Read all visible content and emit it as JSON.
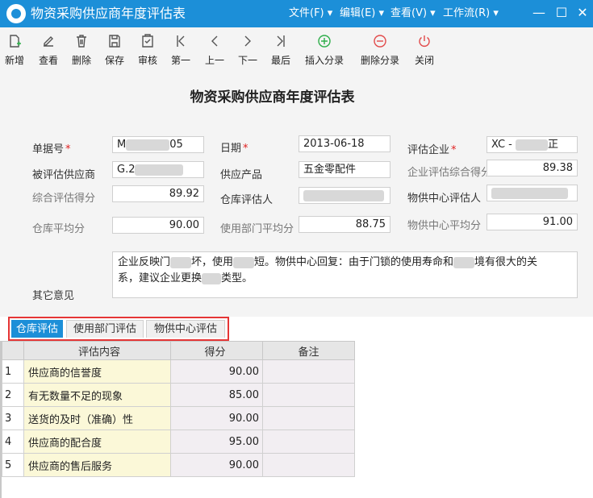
{
  "window": {
    "title": "物资采购供应商年度评估表"
  },
  "menu": [
    {
      "label": "文件(F)"
    },
    {
      "label": "编辑(E)"
    },
    {
      "label": "查看(V)"
    },
    {
      "label": "工作流(R)"
    }
  ],
  "toolbar": [
    {
      "label": "新增",
      "icon": "new-doc-icon"
    },
    {
      "label": "查看",
      "icon": "edit-icon"
    },
    {
      "label": "删除",
      "icon": "trash-icon"
    },
    {
      "label": "保存",
      "icon": "save-icon"
    },
    {
      "label": "审核",
      "icon": "audit-icon"
    },
    {
      "label": "第一",
      "icon": "first-icon"
    },
    {
      "label": "上一",
      "icon": "prev-icon"
    },
    {
      "label": "下一",
      "icon": "next-icon"
    },
    {
      "label": "最后",
      "icon": "last-icon"
    },
    {
      "label": "插入分录",
      "icon": "plus-circle-icon",
      "color": "#2eae4a"
    },
    {
      "label": "删除分录",
      "icon": "minus-circle-icon",
      "color": "#e24a4a"
    },
    {
      "label": "关闭",
      "icon": "power-icon",
      "color": "#e24a4a"
    }
  ],
  "form": {
    "title": "物资采购供应商年度评估表",
    "doc_no_label": "单据号",
    "doc_no_prefix": "M",
    "doc_no_suffix": "05",
    "date_label": "日期",
    "date_value": "2013-06-18",
    "eval_company_label": "评估企业",
    "eval_company_prefix": "XC -",
    "eval_company_suffix": "正",
    "supplier_label": "被评估供应商",
    "supplier_prefix": "G.2",
    "product_label": "供应产品",
    "product_value": "五金零配件",
    "company_score_label": "企业评估综合得分",
    "company_score_value": "89.38",
    "overall_score_label": "综合评估得分",
    "overall_score_value": "89.92",
    "warehouse_evaluator_label": "仓库评估人",
    "supply_center_evaluator_label": "物供中心评估人",
    "warehouse_avg_label": "仓库平均分",
    "warehouse_avg_value": "90.00",
    "dept_avg_label": "使用部门平均分",
    "dept_avg_value": "88.75",
    "supply_center_avg_label": "物供中心平均分",
    "supply_center_avg_value": "91.00",
    "remark_label": "其它意见",
    "remark_line1_a": "企业反映门",
    "remark_line1_b": "坏，使用",
    "remark_line1_c": "短。物供中心回复：由于门锁的使用寿命和",
    "remark_line1_d": "境有很大的关",
    "remark_line2_a": "系，建议企业更换",
    "remark_line2_b": "类型。"
  },
  "tabs": [
    {
      "label": "仓库评估",
      "active": true
    },
    {
      "label": "使用部门评估",
      "active": false
    },
    {
      "label": "物供中心评估",
      "active": false
    }
  ],
  "grid": {
    "headers": [
      "评估内容",
      "得分",
      "备注"
    ],
    "rows": [
      {
        "idx": "1",
        "item": "供应商的信誉度",
        "score": "90.00",
        "note": ""
      },
      {
        "idx": "2",
        "item": "有无数量不足的现象",
        "score": "85.00",
        "note": ""
      },
      {
        "idx": "3",
        "item": "送货的及时（准确）性",
        "score": "90.00",
        "note": ""
      },
      {
        "idx": "4",
        "item": "供应商的配合度",
        "score": "95.00",
        "note": ""
      },
      {
        "idx": "5",
        "item": "供应商的售后服务",
        "score": "90.00",
        "note": ""
      }
    ]
  }
}
